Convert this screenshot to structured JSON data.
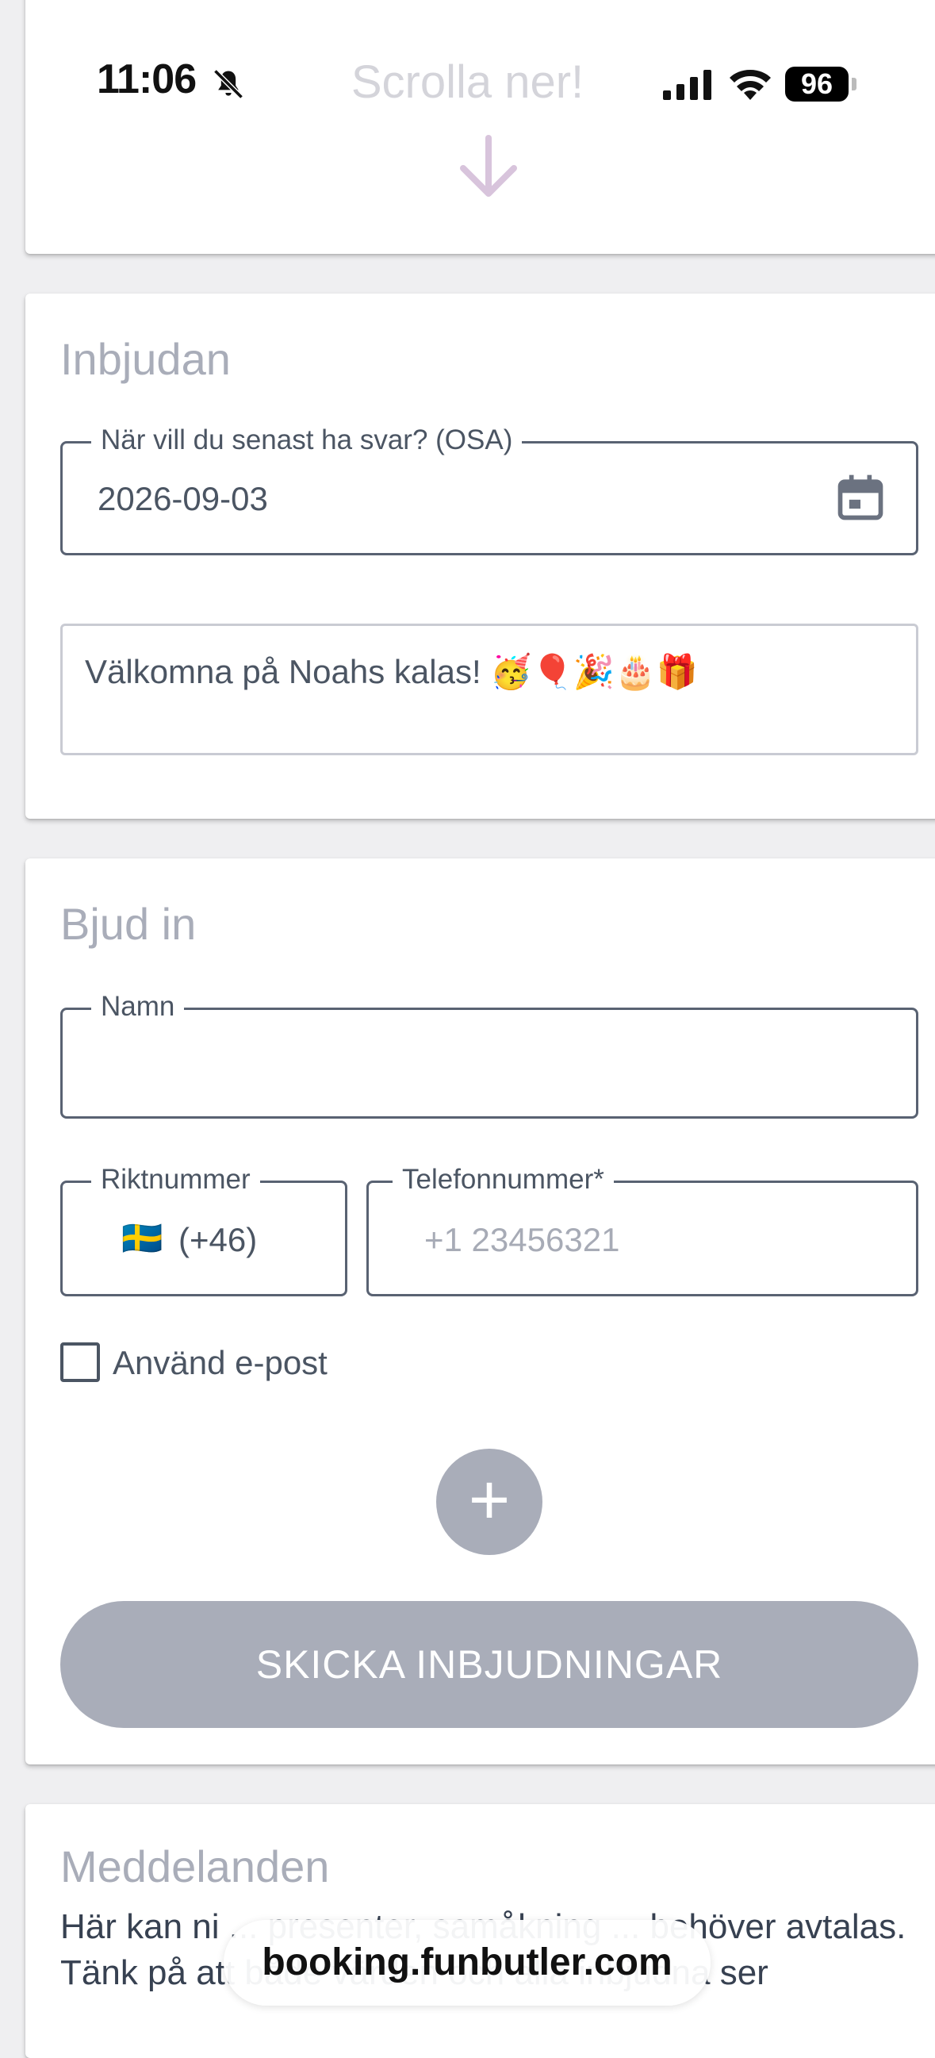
{
  "status_bar": {
    "time": "11:06",
    "battery": "96",
    "icons": [
      "bell-slash-icon",
      "signal-icon",
      "wifi-icon",
      "battery-icon"
    ]
  },
  "scroll_hint": {
    "text": "Scrolla ner!",
    "icon": "arrow-down-icon"
  },
  "invitation": {
    "title": "Inbjudan",
    "osa_label": "När vill du senast ha svar? (OSA)",
    "osa_value": "2026-09-03",
    "calendar_icon": "calendar-icon",
    "message": "Välkomna på Noahs kalas! 🥳🎈🎉🎂🎁"
  },
  "invite": {
    "title": "Bjud in",
    "name_label": "Namn",
    "name_value": "",
    "country_label": "Riktnummer",
    "country_flag": "🇸🇪",
    "country_code": "(+46)",
    "phone_label": "Telefonnummer*",
    "phone_placeholder": "+1 23456321",
    "email_checkbox_label": "Använd e-post",
    "email_checked": false,
    "add_label": "+",
    "submit_label": "SKICKA INBJUDNINGAR"
  },
  "messages": {
    "title": "Meddelanden",
    "body": "Här kan ni ... presenter, samåkning ... behöver avtalas. Tänk på att både värden och alla inbjudna ser"
  },
  "browser": {
    "url": "booking.funbutler.com"
  },
  "colors": {
    "background": "#efeff1",
    "card": "#ffffff",
    "muted_title": "#a9adb9",
    "field_border": "#596272",
    "button": "#a9adb9",
    "scroll_hint": "#d4d4da",
    "arrow": "#d8c4dc"
  }
}
